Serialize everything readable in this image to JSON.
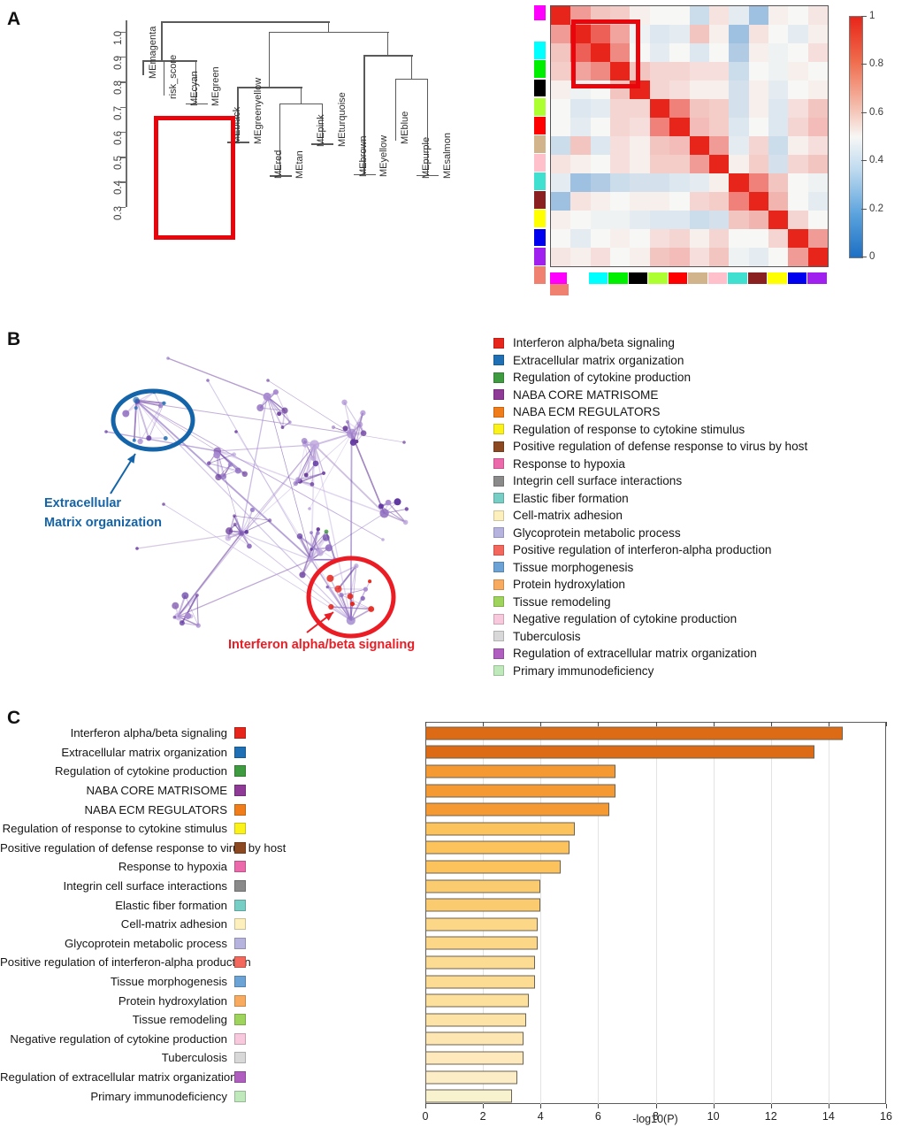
{
  "panels": {
    "a": "A",
    "b": "B",
    "c": "C"
  },
  "panel_a": {
    "dendrogram": {
      "ylabel": "",
      "ytick_labels": [
        "1.0",
        "0.9",
        "0.8",
        "0.7",
        "0.6",
        "0.5",
        "0.4",
        "0.3"
      ],
      "ytick_values": [
        1.0,
        0.9,
        0.8,
        0.7,
        0.6,
        0.5,
        0.4,
        0.3
      ],
      "ylim": [
        0.3,
        1.05
      ],
      "leaves": [
        "MEmagenta",
        "risk_score",
        "MEcyan",
        "MEgreen",
        "MEblack",
        "MEgreenyellow",
        "MEred",
        "MEtan",
        "MEpink",
        "MEturquoise",
        "MEbrown",
        "MEyellow",
        "MEblue",
        "MEpurple",
        "MEsalmon"
      ],
      "highlight_box_members": [
        "risk_score",
        "MEcyan",
        "MEgreen"
      ],
      "highlight_color": "#e8050b"
    },
    "heatmap": {
      "module_colors": [
        "#ff00ff",
        "#00ffff",
        "#00ee00",
        "#000000",
        "#adff2f",
        "#ff0000",
        "#d2b48c",
        "#ffc0cb",
        "#40e0d0",
        "#8b2020",
        "#ffff00",
        "#0000ee",
        "#a020f0",
        "#f08070"
      ],
      "module_names": [
        "magenta",
        "cyan",
        "green",
        "black",
        "greenyellow",
        "red",
        "tan",
        "pink",
        "turquoise",
        "brown",
        "yellow",
        "blue",
        "purple",
        "salmon"
      ],
      "colorbar": {
        "ticks": [
          "1",
          "0.8",
          "0.6",
          "0.4",
          "0.2",
          "0"
        ],
        "tick_values": [
          1,
          0.8,
          0.6,
          0.4,
          0.2,
          0
        ],
        "min": 0,
        "max": 1,
        "low_color": "#1c6fc4",
        "mid_color": "#f7f7f5",
        "high_color": "#e8251a"
      },
      "matrix": [
        [
          1.0,
          0.72,
          0.62,
          0.6,
          0.52,
          0.5,
          0.5,
          0.4,
          0.55,
          0.46,
          0.3,
          0.52,
          0.5,
          0.54
        ],
        [
          0.72,
          1.0,
          0.86,
          0.7,
          0.48,
          0.44,
          0.46,
          0.62,
          0.52,
          0.3,
          0.55,
          0.5,
          0.46,
          0.52
        ],
        [
          0.62,
          0.86,
          1.0,
          0.76,
          0.5,
          0.46,
          0.5,
          0.44,
          0.5,
          0.34,
          0.52,
          0.48,
          0.5,
          0.56
        ],
        [
          0.6,
          0.7,
          0.76,
          1.0,
          0.62,
          0.58,
          0.58,
          0.56,
          0.56,
          0.4,
          0.5,
          0.48,
          0.52,
          0.5
        ],
        [
          0.52,
          0.48,
          0.5,
          0.62,
          1.0,
          0.58,
          0.56,
          0.52,
          0.52,
          0.42,
          0.52,
          0.46,
          0.5,
          0.52
        ],
        [
          0.5,
          0.44,
          0.46,
          0.58,
          0.58,
          1.0,
          0.78,
          0.62,
          0.6,
          0.42,
          0.52,
          0.44,
          0.56,
          0.62
        ],
        [
          0.5,
          0.46,
          0.5,
          0.58,
          0.56,
          0.78,
          1.0,
          0.64,
          0.6,
          0.44,
          0.5,
          0.44,
          0.58,
          0.64
        ],
        [
          0.4,
          0.62,
          0.44,
          0.56,
          0.52,
          0.62,
          0.64,
          1.0,
          0.72,
          0.46,
          0.58,
          0.4,
          0.52,
          0.56
        ],
        [
          0.55,
          0.52,
          0.5,
          0.56,
          0.52,
          0.6,
          0.6,
          0.72,
          1.0,
          0.52,
          0.6,
          0.42,
          0.58,
          0.62
        ],
        [
          0.46,
          0.3,
          0.34,
          0.4,
          0.42,
          0.42,
          0.44,
          0.46,
          0.52,
          1.0,
          0.78,
          0.62,
          0.5,
          0.48
        ],
        [
          0.3,
          0.55,
          0.52,
          0.5,
          0.52,
          0.52,
          0.5,
          0.58,
          0.6,
          0.78,
          1.0,
          0.66,
          0.5,
          0.46
        ],
        [
          0.52,
          0.5,
          0.48,
          0.48,
          0.46,
          0.44,
          0.44,
          0.4,
          0.42,
          0.62,
          0.66,
          1.0,
          0.58,
          0.5
        ],
        [
          0.5,
          0.46,
          0.5,
          0.52,
          0.5,
          0.56,
          0.58,
          0.52,
          0.58,
          0.5,
          0.5,
          0.58,
          1.0,
          0.72
        ],
        [
          0.54,
          0.52,
          0.56,
          0.5,
          0.52,
          0.62,
          0.64,
          0.56,
          0.62,
          0.48,
          0.46,
          0.5,
          0.72,
          1.0
        ]
      ],
      "highlight_color": "#e8050b"
    }
  },
  "panel_b": {
    "annotation_ecm_line1": "Extracellular",
    "annotation_ecm_line2": "Matrix organization",
    "annotation_ecm_color": "#1464aa",
    "annotation_ifn": "Interferon alpha/beta signaling",
    "annotation_ifn_color": "#ec1c24",
    "legend": [
      {
        "label": "Interferon alpha/beta signaling",
        "color": "#e8251a"
      },
      {
        "label": "Extracellular matrix organization",
        "color": "#1f6fb4"
      },
      {
        "label": "Regulation of cytokine production",
        "color": "#3f9b3f"
      },
      {
        "label": "NABA CORE MATRISOME",
        "color": "#8e3a96"
      },
      {
        "label": "NABA ECM REGULATORS",
        "color": "#f07d1a"
      },
      {
        "label": "Regulation of response to cytokine stimulus",
        "color": "#fbf21a"
      },
      {
        "label": "Positive regulation of defense response to virus by host",
        "color": "#8c4820"
      },
      {
        "label": "Response to hypoxia",
        "color": "#ec69ab"
      },
      {
        "label": "Integrin cell surface interactions",
        "color": "#8a8a8a"
      },
      {
        "label": "Elastic fiber formation",
        "color": "#76cec4"
      },
      {
        "label": "Cell-matrix adhesion",
        "color": "#fdf0bd"
      },
      {
        "label": "Glycoprotein metabolic process",
        "color": "#b6b4de"
      },
      {
        "label": "Positive regulation of interferon-alpha production",
        "color": "#f4675c"
      },
      {
        "label": "Tissue morphogenesis",
        "color": "#6ba3d6"
      },
      {
        "label": "Protein hydroxylation",
        "color": "#f8ab5e"
      },
      {
        "label": "Tissue remodeling",
        "color": "#9ed45c"
      },
      {
        "label": "Negative regulation of cytokine production",
        "color": "#f8c8dd"
      },
      {
        "label": "Tuberculosis",
        "color": "#d8d8d8"
      },
      {
        "label": "Regulation of extracellular matrix organization",
        "color": "#b05ec0"
      },
      {
        "label": "Primary immunodeficiency",
        "color": "#bfe8bb"
      }
    ]
  },
  "chart_data": {
    "type": "bar",
    "orientation": "horizontal",
    "title": "",
    "xlabel": "-log10(P)",
    "ylabel": "",
    "xlim": [
      0,
      16
    ],
    "xticks": [
      0,
      2,
      4,
      6,
      8,
      10,
      12,
      14,
      16
    ],
    "xtick_labels": [
      "0",
      "2",
      "4",
      "6",
      "8",
      "10",
      "12",
      "14",
      "16"
    ],
    "grid": true,
    "legend_position": "none",
    "categories": [
      "Interferon alpha/beta signaling",
      "Extracellular matrix organization",
      "Regulation of cytokine production",
      "NABA CORE MATRISOME",
      "NABA ECM REGULATORS",
      "Regulation of response to cytokine stimulus",
      "Positive regulation of defense response to virus by host",
      "Response to hypoxia",
      "Integrin cell surface interactions",
      "Elastic fiber formation",
      "Cell-matrix adhesion",
      "Glycoprotein metabolic process",
      "Positive regulation of interferon-alpha production",
      "Tissue morphogenesis",
      "Protein hydroxylation",
      "Tissue remodeling",
      "Negative regulation of cytokine production",
      "Tuberculosis",
      "Regulation of extracellular matrix organization",
      "Primary immunodeficiency"
    ],
    "values": [
      14.5,
      13.5,
      6.6,
      6.6,
      6.4,
      5.2,
      5.0,
      4.7,
      4.0,
      4.0,
      3.9,
      3.9,
      3.8,
      3.8,
      3.6,
      3.5,
      3.4,
      3.4,
      3.2,
      3.0
    ],
    "bar_colors": [
      "#dd6a14",
      "#dd6a14",
      "#f59a32",
      "#f59a32",
      "#f59a32",
      "#fcc35c",
      "#fcc35c",
      "#fcc35c",
      "#fbcb70",
      "#fbcb70",
      "#fcd787",
      "#fcd787",
      "#fcdc93",
      "#fcdc93",
      "#fde09c",
      "#fde3a5",
      "#fde6b1",
      "#fde9bb",
      "#fdedc6",
      "#f9f2cf"
    ],
    "swatch_colors": [
      "#e8251a",
      "#1f6fb4",
      "#3f9b3f",
      "#8e3a96",
      "#f07d1a",
      "#fbf21a",
      "#8c4820",
      "#ec69ab",
      "#8a8a8a",
      "#76cec4",
      "#fdf0bd",
      "#b6b4de",
      "#f4675c",
      "#6ba3d6",
      "#f8ab5e",
      "#9ed45c",
      "#f8c8dd",
      "#d8d8d8",
      "#b05ec0",
      "#bfe8bb"
    ]
  }
}
